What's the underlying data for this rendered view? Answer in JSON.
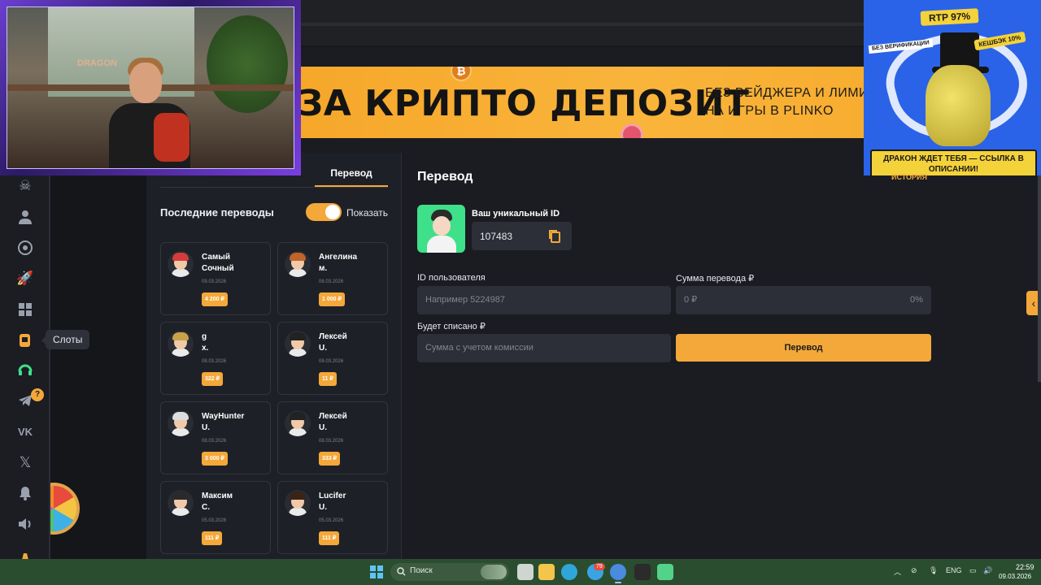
{
  "banner": {
    "headline": "ЗА КРИПТО ДЕПОЗИТ",
    "sub_line1": "БЕЗ ВЕЙДЖЕРА И ЛИМИТ",
    "sub_line2": "НА ИГРЫ В PLINKO",
    "coin_symbol": "₿"
  },
  "sidebar": {
    "tooltip": "Слоты",
    "telegram_badge": "?",
    "icons": [
      "skull-icon",
      "user-icon",
      "target-icon",
      "rocket-icon",
      "dice-icon",
      "slots-icon",
      "support-icon",
      "telegram-icon",
      "vk-icon",
      "x-icon",
      "bell-icon",
      "sound-icon",
      "lamp-icon"
    ]
  },
  "transfers": {
    "tab_label": "Перевод",
    "recent_title": "Последние переводы",
    "show_toggle_label": "Показать",
    "show_toggle_on": true,
    "cards": [
      {
        "name1": "Самый",
        "name2": "Сочный",
        "date": "09.03.2026",
        "amount": "4 200 ₽",
        "hair": "#d43c3c"
      },
      {
        "name1": "Ангелина",
        "name2": "м.",
        "date": "08.03.2026",
        "amount": "1 000 ₽",
        "hair": "#c0642a"
      },
      {
        "name1": "g",
        "name2": "x.",
        "date": "08.03.2026",
        "amount": "322 ₽",
        "hair": "#c9a14a"
      },
      {
        "name1": "Лексей",
        "name2": "U.",
        "date": "08.03.2026",
        "amount": "11 ₽",
        "hair": "#222222"
      },
      {
        "name1": "WayHunter",
        "name2": "U.",
        "date": "08.03.2026",
        "amount": "3 000 ₽",
        "hair": "#dddddd"
      },
      {
        "name1": "Лексей",
        "name2": "U.",
        "date": "08.03.2026",
        "amount": "333 ₽",
        "hair": "#222222"
      },
      {
        "name1": "Максим",
        "name2": "С.",
        "date": "05.03.2026",
        "amount": "111 ₽",
        "hair": "#2a2a2a"
      },
      {
        "name1": "Lucifer",
        "name2": "U.",
        "date": "05.03.2026",
        "amount": "111 ₽",
        "hair": "#3a2418"
      }
    ]
  },
  "transfer_form": {
    "title": "Перевод",
    "unique_id_label": "Ваш уникальный ID",
    "unique_id_value": "107483",
    "user_id_label": "ID пользователя",
    "user_id_placeholder": "Например 5224987",
    "amount_label": "Сумма перевода ₽",
    "amount_placeholder": "0 ₽",
    "commission": "0%",
    "debit_label": "Будет списано ₽",
    "debit_placeholder": "Сумма с учетом комиссии",
    "submit_label": "Перевод"
  },
  "webcam": {
    "sign_text": "DRAGON"
  },
  "ad": {
    "rtp": "RTP 97%",
    "cashback": "КЕШБЭК 10%",
    "no_verification": "БЕЗ ВЕРИФИКАЦИИ",
    "cta": "ДРАКОН ЖДЕТ ТЕБЯ — ССЫЛКА В ОПИСАНИИ!",
    "history_link": "ИСТОРИЯ"
  },
  "taskbar": {
    "search_placeholder": "Поиск",
    "badge": "79",
    "language": "ENG",
    "time": "22:59",
    "date": "09.03.2026"
  }
}
